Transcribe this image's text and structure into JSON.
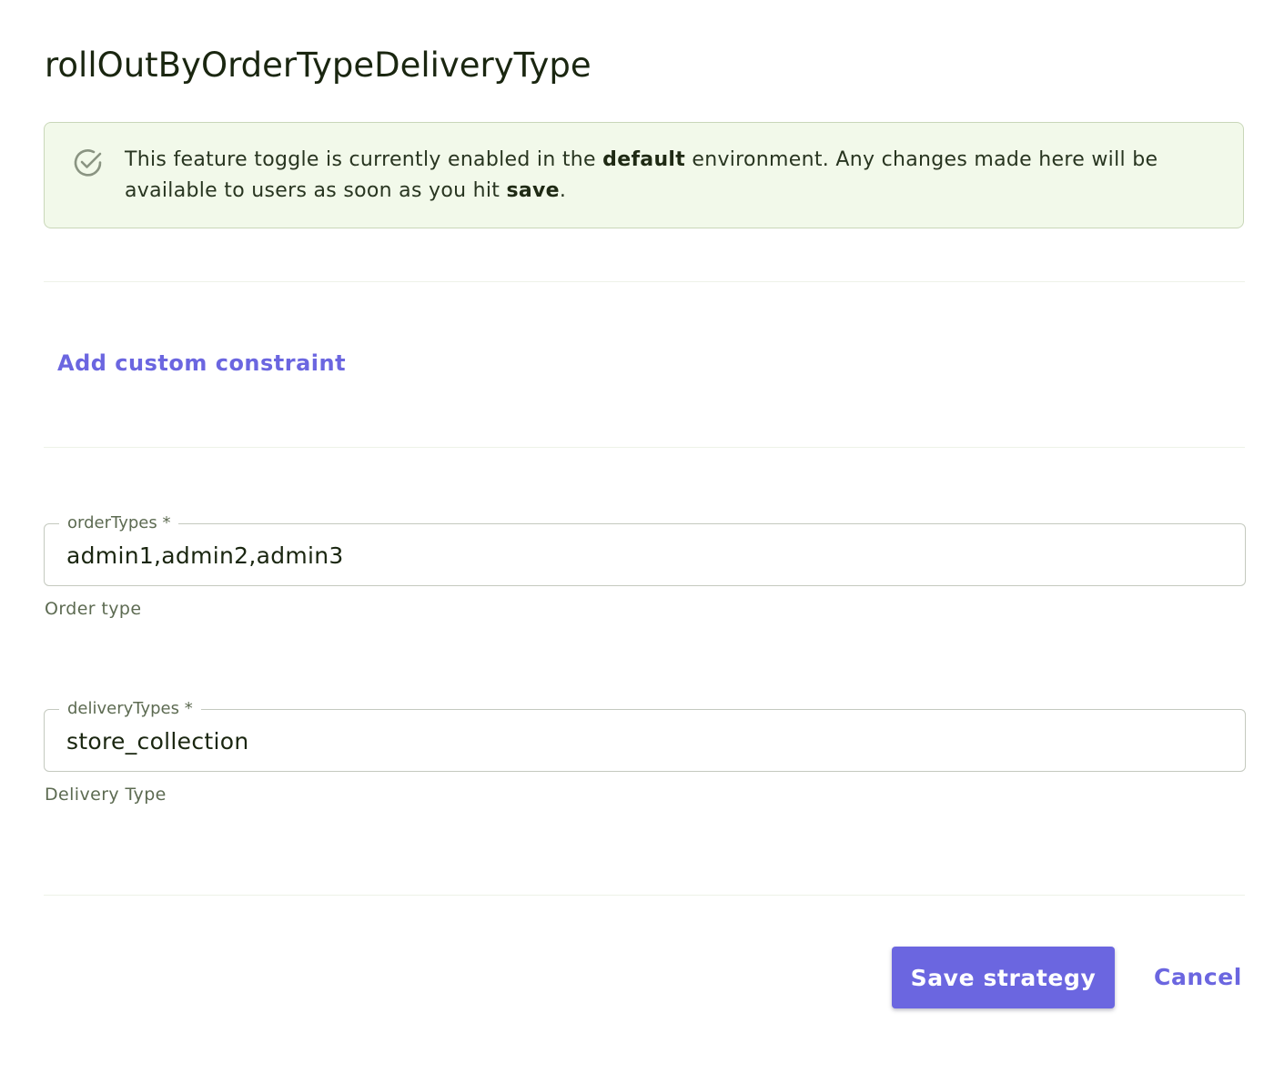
{
  "page": {
    "title": "rollOutByOrderTypeDeliveryType"
  },
  "alert": {
    "text_1": "This feature toggle is currently enabled in the ",
    "env_name": "default",
    "text_2": " environment. Any changes made here will be available to users as soon as you hit ",
    "action_word": "save",
    "text_3": ".",
    "icon": "check-circle-icon"
  },
  "constraints": {
    "add_label": "Add custom constraint"
  },
  "fields": [
    {
      "label": "orderTypes *",
      "value": "admin1,admin2,admin3",
      "helper": "Order type"
    },
    {
      "label": "deliveryTypes *",
      "value": "store_collection",
      "helper": "Delivery Type"
    }
  ],
  "actions": {
    "save_label": "Save strategy",
    "cancel_label": "Cancel"
  },
  "colors": {
    "accent": "#6b66e0",
    "alert_bg": "#f2f9ea",
    "alert_border": "#c9d7b9",
    "text": "#1a2610",
    "muted": "#5d6b52"
  }
}
